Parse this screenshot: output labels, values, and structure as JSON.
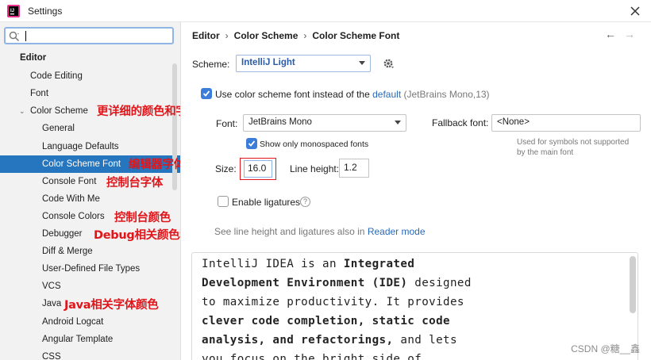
{
  "window": {
    "title": "Settings",
    "close_glyph": "✕"
  },
  "sidebar": {
    "search_value": "",
    "items": [
      {
        "label": "Editor",
        "level": 0,
        "bold": true
      },
      {
        "label": "Code Editing",
        "level": 1
      },
      {
        "label": "Font",
        "level": 1
      },
      {
        "label": "Color Scheme",
        "level": 1,
        "expanded": true
      },
      {
        "label": "General",
        "level": 2
      },
      {
        "label": "Language Defaults",
        "level": 2
      },
      {
        "label": "Color Scheme Font",
        "level": 2,
        "selected": true
      },
      {
        "label": "Console Font",
        "level": 2
      },
      {
        "label": "Code With Me",
        "level": 2
      },
      {
        "label": "Console Colors",
        "level": 2
      },
      {
        "label": "Debugger",
        "level": 2
      },
      {
        "label": "Diff & Merge",
        "level": 2
      },
      {
        "label": "User-Defined File Types",
        "level": 2
      },
      {
        "label": "VCS",
        "level": 2
      },
      {
        "label": "Java",
        "level": 2
      },
      {
        "label": "Android Logcat",
        "level": 2
      },
      {
        "label": "Angular Template",
        "level": 2
      },
      {
        "label": "CSS",
        "level": 2
      }
    ],
    "annotations": {
      "color_scheme": "更详细的颜色和字体",
      "color_scheme_font": "编辑器字体",
      "console_font": "控制台字体",
      "console_colors": "控制台颜色",
      "debugger": "Debug相关颜色和字体",
      "java": "Java相关字体颜色"
    }
  },
  "breadcrumb": {
    "items": [
      "Editor",
      "Color Scheme",
      "Color Scheme Font"
    ],
    "separator": "›",
    "back_glyph": "←",
    "forward_glyph": "→"
  },
  "scheme": {
    "label": "Scheme:",
    "value": "IntelliJ Light"
  },
  "use_scheme_font": {
    "checked": true,
    "label": "Use color scheme font instead of the",
    "link": "default",
    "hint": "(JetBrains Mono,13)"
  },
  "font": {
    "label": "Font:",
    "value": "JetBrains Mono",
    "fallback_label": "Fallback font:",
    "fallback_value": "<None>",
    "fallback_hint_line1": "Used for symbols not supported",
    "fallback_hint_line2": "by the main font",
    "monospaced_checked": true,
    "monospaced_label": "Show only monospaced fonts"
  },
  "size": {
    "label": "Size:",
    "value": "16.0",
    "line_height_label": "Line height:",
    "line_height_value": "1.2"
  },
  "ligatures": {
    "checked": false,
    "label": "Enable ligatures",
    "help_glyph": "?"
  },
  "see_also": {
    "text": "See line height and ligatures also in",
    "link": "Reader mode"
  },
  "preview": {
    "lines": [
      [
        {
          "t": "IntelliJ IDEA is an ",
          "b": false
        },
        {
          "t": "Integrated",
          "b": true
        }
      ],
      [
        {
          "t": "Development Environment (IDE)",
          "b": true
        },
        {
          "t": " designed",
          "b": false
        }
      ],
      [
        {
          "t": "to maximize productivity. It provides",
          "b": false
        }
      ],
      [
        {
          "t": "clever code completion, static code",
          "b": true
        }
      ],
      [
        {
          "t": "analysis, and refactorings,",
          "b": true
        },
        {
          "t": " and lets",
          "b": false
        }
      ],
      [
        {
          "t": "you focus on the bright side of",
          "b": false
        }
      ]
    ]
  },
  "watermark": "CSDN @糖__鑫",
  "colors": {
    "accent": "#2675bf",
    "annotation": "#e0161b",
    "link": "#2a6ab8"
  }
}
